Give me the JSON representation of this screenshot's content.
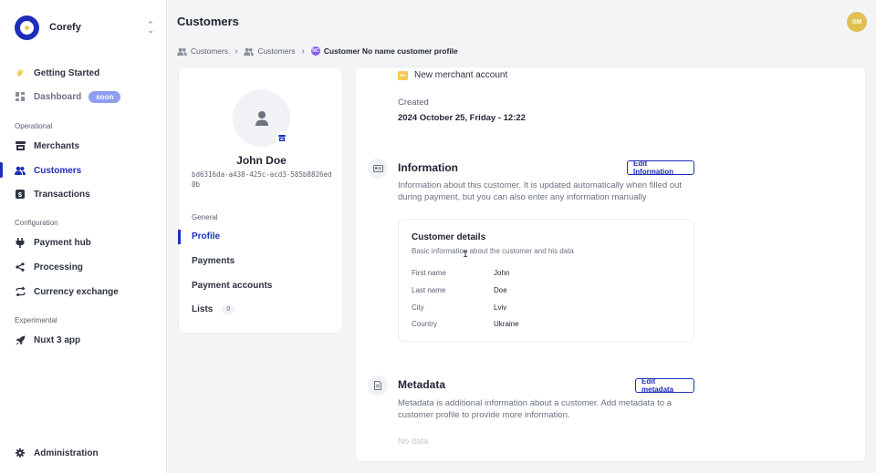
{
  "brand": {
    "name": "Corefy",
    "switch_icon": "chevron-up-down-icon",
    "color": "#1d2fb8"
  },
  "sidebar": {
    "top_items": [
      {
        "label": "Getting Started",
        "icon": "waving-hand-icon"
      },
      {
        "label": "Dashboard",
        "icon": "dashboard-icon",
        "badge": "soon"
      }
    ],
    "sections": [
      {
        "title": "Operational",
        "items": [
          {
            "label": "Merchants",
            "icon": "store-icon"
          },
          {
            "label": "Customers",
            "icon": "users-icon",
            "active": true
          },
          {
            "label": "Transactions",
            "icon": "dollar-icon"
          }
        ]
      },
      {
        "title": "Configuration",
        "items": [
          {
            "label": "Payment hub",
            "icon": "plug-icon"
          },
          {
            "label": "Processing",
            "icon": "share-icon"
          },
          {
            "label": "Currency exchange",
            "icon": "exchange-icon"
          }
        ]
      },
      {
        "title": "Experimental",
        "items": [
          {
            "label": "Nuxt 3 app",
            "icon": "rocket-icon"
          }
        ]
      }
    ],
    "bottom_item": {
      "label": "Administration",
      "icon": "gear-icon"
    }
  },
  "header": {
    "title": "Customers",
    "avatar_initials": "SM"
  },
  "breadcrumb": {
    "items": [
      "Customers",
      "Customers"
    ],
    "current_badge": "NC",
    "current": "Customer No name customer profile"
  },
  "profile": {
    "name": "John Doe",
    "id": "bd6316da-a438-425c-acd3-585b8826ed0b",
    "group_label": "General",
    "links": [
      {
        "label": "Profile",
        "active": true
      },
      {
        "label": "Payments"
      },
      {
        "label": "Payment accounts"
      },
      {
        "label": "Lists",
        "count": "0"
      }
    ]
  },
  "main": {
    "account_badge": "NA",
    "account_label": "New merchant account",
    "created_label": "Created",
    "created_value": "2024 October 25, Friday - 12:22",
    "information": {
      "title": "Information",
      "button": "Edit Information",
      "description": "Information about this customer. It is updated automatically when filled out during payment, but you can also enter any information manually",
      "details_title": "Customer details",
      "details_subtitle": "Basic information about the customer and his data",
      "fields": [
        {
          "key": "First name",
          "value": "John"
        },
        {
          "key": "Last name",
          "value": "Doe"
        },
        {
          "key": "City",
          "value": "Lviv"
        },
        {
          "key": "Country",
          "value": "Ukraine"
        }
      ]
    },
    "metadata": {
      "title": "Metadata",
      "button": "Edit metadata",
      "description": "Metadata is additional information about a customer. Add metadata to a customer profile to provide more information.",
      "empty": "No data"
    }
  }
}
